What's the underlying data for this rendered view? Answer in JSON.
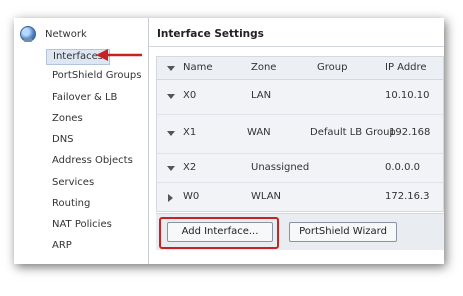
{
  "sidebar": {
    "root_label": "Network",
    "items": [
      {
        "label": "Interfaces"
      },
      {
        "label": "PortShield Groups"
      },
      {
        "label": "Failover & LB"
      },
      {
        "label": "Zones"
      },
      {
        "label": "DNS"
      },
      {
        "label": "Address Objects"
      },
      {
        "label": "Services"
      },
      {
        "label": "Routing"
      },
      {
        "label": "NAT Policies"
      },
      {
        "label": "ARP"
      }
    ]
  },
  "main": {
    "title": "Interface Settings",
    "columns": [
      "Name",
      "Zone",
      "Group",
      "IP Addre"
    ],
    "rows": [
      {
        "name": "X0",
        "zone": "LAN",
        "group": "",
        "ip": "10.10.10"
      },
      {
        "name": "X1",
        "zone": "WAN",
        "group": "Default LB Group",
        "ip": "192.168"
      },
      {
        "name": "X2",
        "zone": "Unassigned",
        "group": "",
        "ip": "0.0.0.0"
      },
      {
        "name": "W0",
        "zone": "WLAN",
        "group": "",
        "ip": "172.16.3"
      }
    ],
    "buttons": {
      "add_interface": "Add Interface...",
      "portshield_wizard": "PortShield Wizard"
    }
  },
  "colors": {
    "highlight": "#c62424",
    "selected_bg": "#dde6f3"
  },
  "icons": {
    "root": "globe-network-icon",
    "annotation": "red-arrow-icon"
  }
}
